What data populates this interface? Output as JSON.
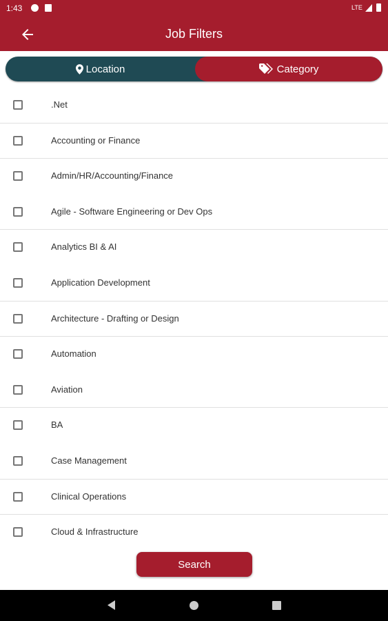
{
  "status_bar": {
    "time": "1:43",
    "network": "LTE"
  },
  "app_bar": {
    "title": "Job Filters"
  },
  "tabs": {
    "location": "Location",
    "category": "Category"
  },
  "categories": [
    ".Net",
    "Accounting or Finance",
    "Admin/HR/Accounting/Finance",
    "Agile - Software Engineering or Dev Ops",
    "Analytics BI & AI",
    "Application Development",
    "Architecture - Drafting or Design",
    "Automation",
    "Aviation",
    "BA",
    "Case Management",
    "Clinical Operations",
    "Cloud & Infrastructure"
  ],
  "search_label": "Search",
  "colors": {
    "primary": "#a51d2d",
    "secondary": "#1f4a54"
  }
}
